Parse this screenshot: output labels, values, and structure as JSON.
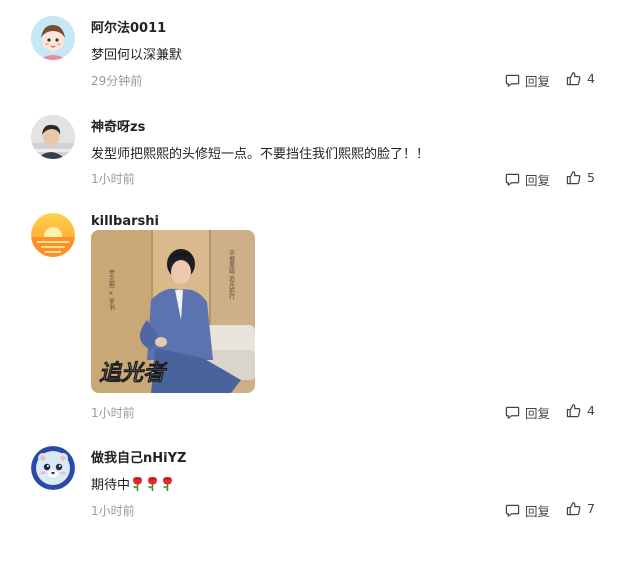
{
  "actions": {
    "reply_label": "回复"
  },
  "comments": [
    {
      "username": "阿尔法0011",
      "text": "梦回何以深兼默",
      "time": "29分钟前",
      "likes": "4",
      "avatar": "cartoon-avatar"
    },
    {
      "username": "神奇呀zs",
      "text": "发型师把熙熙的头修短一点。不要挡住我们熙熙的脸了！！",
      "time": "1小时前",
      "likes": "5",
      "avatar": "photo-avatar"
    },
    {
      "username": "killbarshi",
      "text": "",
      "time": "1小时前",
      "likes": "4",
      "avatar": "sunset-avatar",
      "image": {
        "title": "追光者",
        "vertical_left": "罗云熙 × 罗书",
        "vertical_right": "不惧黑暗 追光前行"
      }
    },
    {
      "username": "做我自己nHiYZ",
      "text": "期待中",
      "time": "1小时前",
      "likes": "7",
      "avatar": "bear-avatar",
      "emoji": "rose-emoji"
    }
  ]
}
